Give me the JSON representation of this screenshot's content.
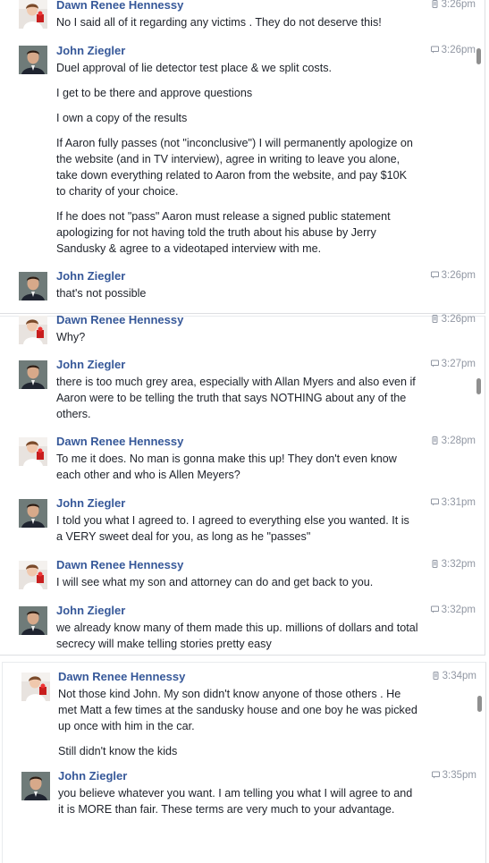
{
  "panel1": {
    "msg1": {
      "author": "Dawn Renee Hennessy",
      "time": "3:26pm",
      "text": "No I said all of it regarding any victims . They do not deserve this!"
    },
    "msg2": {
      "author": "John Ziegler",
      "time": "3:26pm",
      "p1": "Duel approval of lie detector test place & we split costs.",
      "p2": "I get to be there and approve questions",
      "p3": "I own a copy of the results",
      "p4a": "If Aaron fully passes (not \"inconclusive\") I will permanently apologize on",
      "p4b": "the website (and in TV interview), agree in writing to leave you alone,",
      "p4c": "take down everything related to Aaron from the website, and pay $10K",
      "p4d": "to charity of your choice.",
      "p5a": "If he does not \"pass\" Aaron must release a signed public statement",
      "p5b": "apologizing for not having told the truth about his abuse by Jerry",
      "p5c": "Sandusky & agree to a videotaped interview with me."
    },
    "msg3": {
      "author": "John Ziegler",
      "time": "3:26pm",
      "text": "that's not possible"
    }
  },
  "panel2": {
    "msg1": {
      "author": "Dawn Renee Hennessy",
      "time": "3:26pm",
      "text": "Why?"
    },
    "msg2": {
      "author": "John Ziegler",
      "time": "3:27pm",
      "l1": "there is too much grey area, especially with Allan Myers and also even if",
      "l2": "Aaron were to be telling the truth that says NOTHING about any of the",
      "l3": "others."
    },
    "msg3": {
      "author": "Dawn Renee Hennessy",
      "time": "3:28pm",
      "l1": "To me it does. No man is gonna make this up! They don't even know",
      "l2": "each other and who is Allen Meyers?"
    },
    "msg4": {
      "author": "John Ziegler",
      "time": "3:31pm",
      "l1": "I told you what I agreed to. I agreed to everything else you wanted. It is",
      "l2": "a VERY sweet deal for you, as long as he \"passes\""
    },
    "msg5": {
      "author": "Dawn Renee Hennessy",
      "time": "3:32pm",
      "text": "I will see what my son and attorney can do and get back to you."
    },
    "msg6": {
      "author": "John Ziegler",
      "time": "3:32pm",
      "l1": "we already know many of them made this up. millions of dollars and total",
      "l2": "secrecy will make telling stories pretty easy"
    }
  },
  "panel3": {
    "msg1": {
      "author": "Dawn Renee Hennessy",
      "time": "3:34pm",
      "l1": "Not those kind John. My son didn't know anyone of those others . He",
      "l2": "met Matt a few times at the sandusky house and one boy he was picked",
      "l3": "up once with him in the car.",
      "l4": "Still didn't know the kids"
    },
    "msg2": {
      "author": "John Ziegler",
      "time": "3:35pm",
      "l1": "you believe whatever you want. I am telling you what I will agree to and",
      "l2": "it is MORE than fair. These terms are very much to your advantage."
    }
  },
  "icons": {
    "sent": "mobile-phone-icon",
    "chat": "chat-bubble-icon"
  },
  "colors": {
    "author": "#365899",
    "text": "#1d2129",
    "timestamp": "#9197a3",
    "divider": "#dddfe2"
  }
}
